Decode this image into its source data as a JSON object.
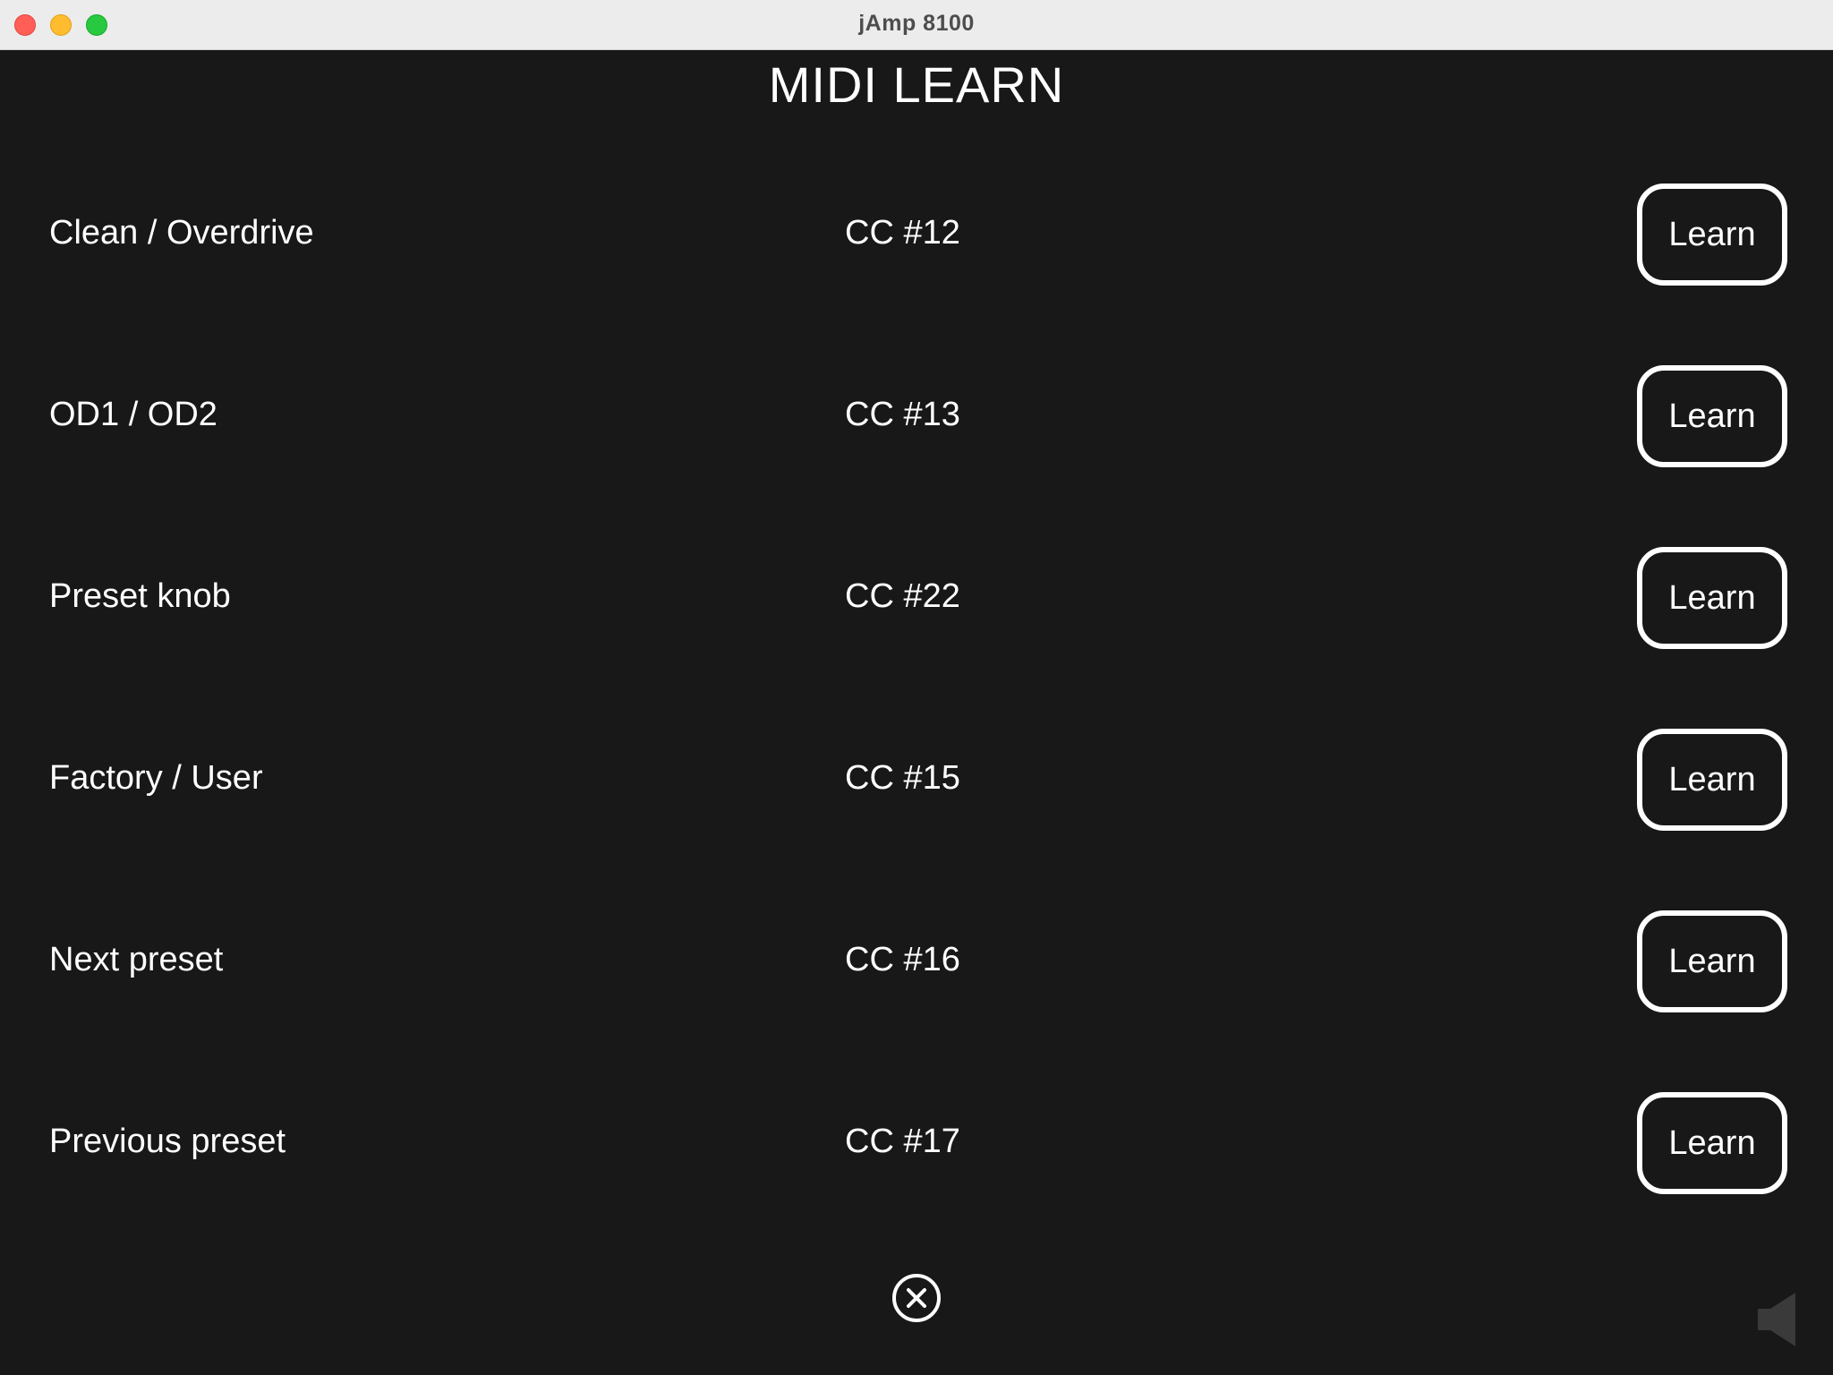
{
  "window": {
    "title": "jAmp 8100"
  },
  "page": {
    "title": "MIDI LEARN"
  },
  "mappings": [
    {
      "label": "Clean / Overdrive",
      "value": "CC #12",
      "button": "Learn"
    },
    {
      "label": "OD1 / OD2",
      "value": "CC #13",
      "button": "Learn"
    },
    {
      "label": "Preset knob",
      "value": "CC #22",
      "button": "Learn"
    },
    {
      "label": "Factory / User",
      "value": "CC #15",
      "button": "Learn"
    },
    {
      "label": "Next preset",
      "value": "CC #16",
      "button": "Learn"
    },
    {
      "label": "Previous preset",
      "value": "CC #17",
      "button": "Learn"
    }
  ],
  "icons": {
    "close": "close-circle-icon",
    "speaker": "speaker-icon"
  },
  "colors": {
    "background": "#181818",
    "text": "#ffffff",
    "titlebar": "#ececec"
  }
}
